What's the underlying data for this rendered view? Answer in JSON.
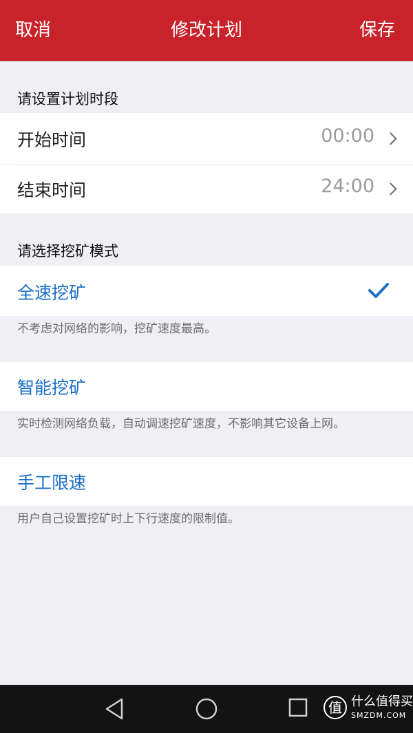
{
  "header": {
    "cancel_label": "取消",
    "title": "修改计划",
    "save_label": "保存",
    "background_color": "#c8232a"
  },
  "time_section": {
    "title": "请设置计划时段",
    "start": {
      "label": "开始时间",
      "value": "00:00"
    },
    "end": {
      "label": "结束时间",
      "value": "24:00"
    }
  },
  "mode_section": {
    "title": "请选择挖矿模式",
    "options": [
      {
        "label": "全速挖矿",
        "selected": true,
        "description": "不考虑对网络的影响，挖矿速度最高。"
      },
      {
        "label": "智能挖矿",
        "selected": false,
        "description": "实时检测网络负载，自动调速挖矿速度，不影响其它设备上网。"
      },
      {
        "label": "手工限速",
        "selected": false,
        "description": "用户自己设置挖矿时上下行速度的限制值。"
      }
    ],
    "accent_color": "#1a6fc9"
  },
  "navbar": {
    "icons": [
      "back-triangle-icon",
      "home-circle-icon",
      "recents-square-icon"
    ]
  },
  "watermark": {
    "logo_char": "值",
    "text": "什么值得买",
    "sub": "SMZDM.COM"
  }
}
